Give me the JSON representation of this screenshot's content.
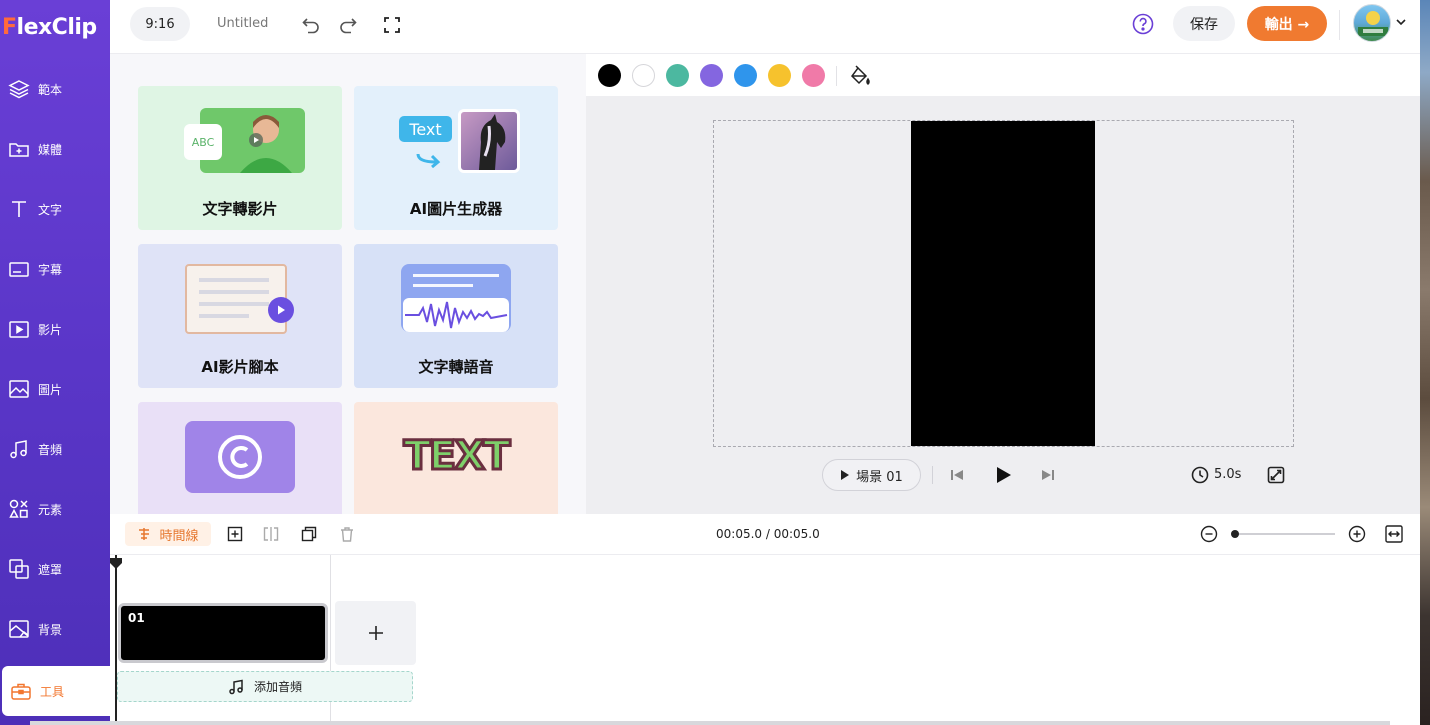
{
  "app": {
    "logo_text": "lexClip",
    "logo_letter": "F"
  },
  "sidebar": {
    "items": [
      {
        "label": "範本",
        "icon": "layers-icon"
      },
      {
        "label": "媒體",
        "icon": "folder-plus-icon"
      },
      {
        "label": "文字",
        "icon": "text-t-icon"
      },
      {
        "label": "字幕",
        "icon": "subtitle-icon"
      },
      {
        "label": "影片",
        "icon": "video-icon"
      },
      {
        "label": "圖片",
        "icon": "image-icon"
      },
      {
        "label": "音頻",
        "icon": "music-icon"
      },
      {
        "label": "元素",
        "icon": "elements-icon"
      },
      {
        "label": "遮罩",
        "icon": "mask-icon"
      },
      {
        "label": "背景",
        "icon": "background-icon"
      },
      {
        "label": "工具",
        "icon": "toolbox-icon",
        "active": true
      }
    ]
  },
  "header": {
    "ratio": "9:16",
    "title": "Untitled",
    "save_label": "保存",
    "export_label": "輸出 →"
  },
  "tools": {
    "cards": [
      {
        "label": "文字轉影片",
        "bg": "#dff5e4"
      },
      {
        "label": "AI圖片生成器",
        "bg": "#e3f0fb"
      },
      {
        "label": "AI影片腳本",
        "bg": "#dfe3f7"
      },
      {
        "label": "文字轉語音",
        "bg": "#d7e1f7"
      },
      {
        "label": "",
        "bg": "#e9e0f7"
      },
      {
        "label": "",
        "bg": "#fbe7dd"
      }
    ],
    "art_text_abc": "ABC",
    "art_text_text": "Text",
    "art_text_big": "TEXT"
  },
  "colors": [
    "#000000",
    "#ffffff",
    "#4cb8a0",
    "#8466e0",
    "#2f95ec",
    "#f6c22d",
    "#f07aa8"
  ],
  "player": {
    "scene_label": "場景 01",
    "duration": "5.0s"
  },
  "timeline": {
    "tab_label": "時間線",
    "time": "00:05.0 / 00:05.0",
    "clip_number": "01",
    "add_audio_label": "添加音頻"
  }
}
